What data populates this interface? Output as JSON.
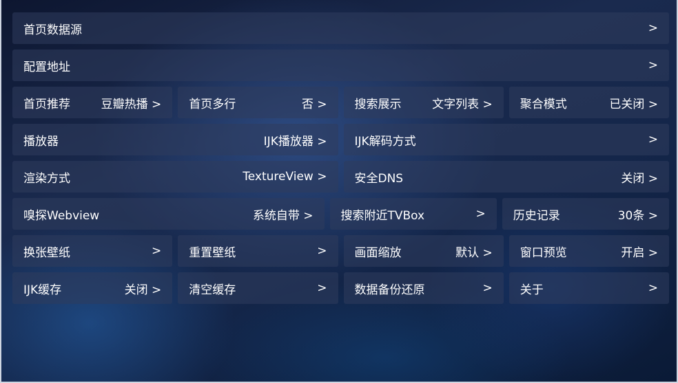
{
  "settings": {
    "home_source": {
      "label": "首页数据源",
      "value": ">"
    },
    "config_url": {
      "label": "配置地址",
      "value": ">"
    },
    "home_recommend": {
      "label": "首页推荐",
      "value": "豆瓣热播 >"
    },
    "home_multirow": {
      "label": "首页多行",
      "value": "否 >"
    },
    "search_display": {
      "label": "搜索展示",
      "value": "文字列表 >"
    },
    "aggregate_mode": {
      "label": "聚合模式",
      "value": "已关闭 >"
    },
    "player": {
      "label": "播放器",
      "value": "IJK播放器 >"
    },
    "ijk_decode": {
      "label": "IJK解码方式",
      "value": ">"
    },
    "render_mode": {
      "label": "渲染方式",
      "value": "TextureView >"
    },
    "secure_dns": {
      "label": "安全DNS",
      "value": "关闭 >"
    },
    "sniff_webview": {
      "label": "嗅探Webview",
      "value": "系统自带 >"
    },
    "search_nearby": {
      "label": "搜索附近TVBox",
      "value": ">"
    },
    "history": {
      "label": "历史记录",
      "value": "30条 >"
    },
    "change_wallpaper": {
      "label": "换张壁纸",
      "value": ">"
    },
    "reset_wallpaper": {
      "label": "重置壁纸",
      "value": ">"
    },
    "picture_scale": {
      "label": "画面缩放",
      "value": "默认 >"
    },
    "window_preview": {
      "label": "窗口预览",
      "value": "开启 >"
    },
    "ijk_cache": {
      "label": "IJK缓存",
      "value": "关闭 >"
    },
    "clear_cache": {
      "label": "清空缓存",
      "value": ">"
    },
    "backup_restore": {
      "label": "数据备份还原",
      "value": ">"
    },
    "about": {
      "label": "关于",
      "value": ">"
    }
  }
}
